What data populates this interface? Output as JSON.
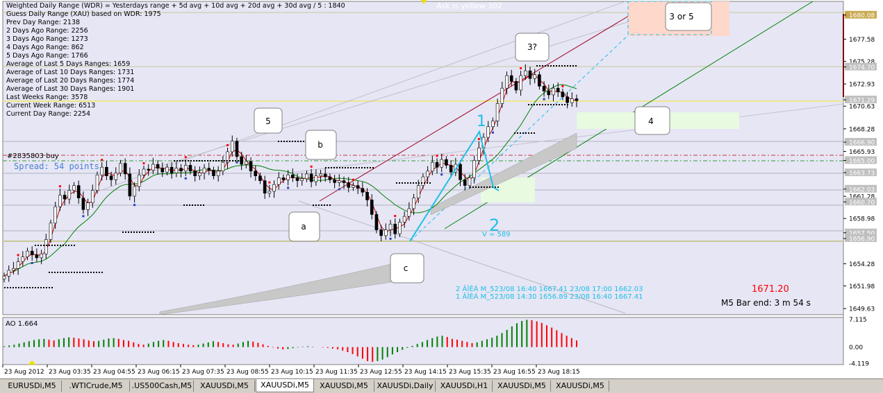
{
  "info_lines": [
    "Weighted Daily Range (WDR) = Yesterdays range + 5d avg + 10d avg + 20d avg + 30d avg / 5 : 1840",
    "Guess Daily Range (XAU) based on WDR: 1975",
    "Prev Day Range: 2138",
    "2 Days Ago Range: 2256",
    "3 Days Ago Range: 1273",
    "4 Days Ago Range: 862",
    "5 Days Ago Range: 1766",
    "Average of Last 5 Days Ranges: 1659",
    "Average of Last 10 Days Ranges: 1731",
    "Average of Last 20 Days Ranges: 1774",
    "Average of Last 30 Days Ranges: 1901",
    "Last Weeks Range: 3578",
    "Current Week Range: 6513",
    "Current Day Range: 2254"
  ],
  "top_text": "Ask is yellow 302",
  "order_label": "#2835803 buy",
  "spread_label": "Spread: 54 points",
  "price_current": "1671.20",
  "bar_end_label": "M5 Bar end: 3 m 54 s",
  "wave_labels": {
    "w1": "1",
    "w2": "2",
    "v_label": "V = 589"
  },
  "callouts": {
    "five": "5",
    "b": "b",
    "a": "a",
    "c": "c",
    "three_q": "3?",
    "four": "4",
    "three_or_five": "3 or 5"
  },
  "wave_info": [
    "2 ÂÎÈÁ M_523/08 16:40 1667.41 23/08 17:00 1662.03",
    "1 ÂÎÈÁ M_523/08 14:30 1656.89 23/08 16:40 1667.41"
  ],
  "ao_label": "AO 1.664",
  "colors": {
    "bg": "#e6e6f5",
    "bull": "#008000",
    "bear": "#ff0000",
    "ma_red": "#cc0000",
    "ma_green": "#008000",
    "wave": "#1ebfe6",
    "current_price": "#ff0000"
  },
  "tabs": [
    "EURUSDi,M5",
    ".WTICrude,M5",
    ".US500Cash,M5",
    "XAUUSDi,M5",
    "XAUUSDi,M5",
    "XAUUSDi,M5",
    "XAUUSDi,Daily",
    "XAUUSDi,H1",
    "XAUUSDi,M5",
    "XAUUSDi,M5"
  ],
  "active_tab": 4,
  "chart_data": {
    "type": "candlestick",
    "symbol": "XAUUSDi",
    "timeframe": "M5",
    "price_ticks": [
      "1680.08",
      "1677.58",
      "1675.28",
      "1674.70",
      "1672.93",
      "1671.29",
      "1670.63",
      "1668.28",
      "1666.90",
      "1665.93",
      "1665.00",
      "1663.73",
      "1662.03",
      "1661.28",
      "1660.70",
      "1658.98",
      "1657.50",
      "1656.90",
      "1654.28",
      "1651.98",
      "1649.63"
    ],
    "ao_ticks": [
      "7.115",
      "0.00",
      "-4.119"
    ],
    "time_ticks": [
      "23 Aug 2012",
      "23 Aug 03:35",
      "23 Aug 04:55",
      "23 Aug 06:15",
      "23 Aug 07:35",
      "23 Aug 08:55",
      "23 Aug 10:15",
      "23 Aug 11:35",
      "23 Aug 12:55",
      "23 Aug 14:15",
      "23 Aug 15:35",
      "23 Aug 16:55",
      "23 Aug 18:15"
    ],
    "ylim": [
      1649.0,
      1681.5
    ],
    "ao_ylim": [
      -4.5,
      7.6
    ],
    "close_path": [
      1653.0,
      1653.6,
      1653.8,
      1654.5,
      1655.0,
      1655.6,
      1655.2,
      1654.9,
      1655.3,
      1656.8,
      1658.5,
      1660.2,
      1661.4,
      1661.0,
      1661.9,
      1662.4,
      1661.1,
      1659.9,
      1660.6,
      1661.9,
      1663.5,
      1664.3,
      1663.4,
      1663.0,
      1663.7,
      1664.7,
      1663.6,
      1661.3,
      1662.3,
      1663.5,
      1664.1,
      1664.0,
      1664.6,
      1664.2,
      1663.8,
      1664.3,
      1663.7,
      1664.2,
      1663.9,
      1664.5,
      1663.9,
      1663.4,
      1663.7,
      1664.2,
      1664.0,
      1663.4,
      1663.9,
      1664.8,
      1665.9,
      1667.0,
      1665.4,
      1664.6,
      1664.9,
      1663.9,
      1663.4,
      1662.9,
      1661.6,
      1661.8,
      1662.5,
      1663.2,
      1663.0,
      1663.5,
      1663.2,
      1662.9,
      1663.1,
      1663.6,
      1662.8,
      1663.4,
      1663.6,
      1663.3,
      1663.0,
      1662.7,
      1662.9,
      1662.7,
      1662.2,
      1662.4,
      1662.1,
      1661.7,
      1660.9,
      1659.4,
      1657.8,
      1657.2,
      1657.8,
      1658.4,
      1657.4,
      1658.6,
      1659.2,
      1660.0,
      1661.1,
      1662.4,
      1663.3,
      1663.9,
      1664.8,
      1664.3,
      1665.1,
      1664.5,
      1663.8,
      1664.6,
      1663.0,
      1662.4,
      1663.2,
      1665.0,
      1666.3,
      1667.4,
      1668.5,
      1669.1,
      1670.9,
      1672.5,
      1673.8,
      1673.2,
      1672.3,
      1673.8,
      1674.3,
      1673.5,
      1673.9,
      1672.7,
      1672.2,
      1671.8,
      1672.5,
      1672.1,
      1671.6,
      1671.0,
      1671.4,
      1671.2
    ],
    "ao_path": [
      0.2,
      0.4,
      0.6,
      0.9,
      1.2,
      1.5,
      1.8,
      2.0,
      2.1,
      1.9,
      1.7,
      2.0,
      2.3,
      2.5,
      2.4,
      2.2,
      2.0,
      1.7,
      1.5,
      1.6,
      1.9,
      2.2,
      2.3,
      2.1,
      1.8,
      1.6,
      1.2,
      0.8,
      0.6,
      0.9,
      1.3,
      1.6,
      1.8,
      1.6,
      1.3,
      1.0,
      0.8,
      0.6,
      0.5,
      0.6,
      0.9,
      1.2,
      1.5,
      1.3,
      1.0,
      0.7,
      0.6,
      0.9,
      1.3,
      1.6,
      1.4,
      1.1,
      0.7,
      0.3,
      -0.1,
      -0.4,
      -0.6,
      -0.5,
      -0.3,
      -0.1,
      0.1,
      0.2,
      0.1,
      0.0,
      -0.1,
      -0.2,
      -0.4,
      -0.6,
      -0.9,
      -1.3,
      -1.8,
      -2.4,
      -3.0,
      -3.6,
      -3.8,
      -3.6,
      -3.2,
      -2.6,
      -1.9,
      -1.3,
      -0.7,
      -0.2,
      0.3,
      0.8,
      1.3,
      1.8,
      2.3,
      2.7,
      2.9,
      2.6,
      2.1,
      1.9,
      1.6,
      1.3,
      1.0,
      1.2,
      1.6,
      2.0,
      2.4,
      2.9,
      3.6,
      4.4,
      5.3,
      6.1,
      6.7,
      7.0,
      6.9,
      6.6,
      6.2,
      5.6,
      5.0,
      4.3,
      3.6,
      2.9,
      2.3,
      1.7
    ]
  }
}
